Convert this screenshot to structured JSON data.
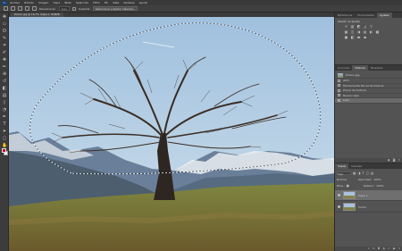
{
  "app": {
    "logo": "Ps"
  },
  "menubar": {
    "items": [
      "Archivo",
      "Edición",
      "Imagen",
      "Capa",
      "Texto",
      "Selección",
      "Filtro",
      "3D",
      "Vista",
      "Ventana",
      "Ayuda"
    ]
  },
  "options": {
    "feather_label": "Desvanecer:",
    "feather_value": "0 px",
    "antialias_label": "Suavizar",
    "refine_button": "Seleccionar y aplicar máscara..."
  },
  "document": {
    "tab_title": "Pinzon.jpg @ 16,7% (Capa 1, RGB/8)"
  },
  "toolbar": {
    "fg_color": "#c8102e",
    "bg_color": "#ffffff",
    "tools": [
      "move-icon",
      "marquee-icon",
      "lasso-icon",
      "quick-select-icon",
      "crop-icon",
      "eyedropper-icon",
      "healing-icon",
      "brush-icon",
      "clone-icon",
      "history-brush-icon",
      "eraser-icon",
      "gradient-icon",
      "blur-icon",
      "dodge-icon",
      "pen-icon",
      "type-icon",
      "path-select-icon",
      "shape-icon",
      "hand-icon",
      "zoom-icon"
    ]
  },
  "adjustments": {
    "tabs": [
      "Bibliotecas",
      "Propiedades",
      "Ajustes"
    ],
    "active_tab": "Ajustes",
    "add_label": "Añadir un ajuste",
    "icons_row1": [
      "☼",
      "▥",
      "◩",
      "◿",
      "▽",
      "",
      "",
      ""
    ],
    "icons_row2": [
      "▦",
      "◫",
      "◑",
      "▤",
      "◐",
      "▩",
      "",
      ""
    ],
    "icons_row3": [
      "▣",
      "◧",
      "▬",
      "▪",
      "",
      "",
      "",
      ""
    ]
  },
  "history": {
    "tabs": [
      "Acciones",
      "Historia",
      "Muestras"
    ],
    "active_tab": "Historia",
    "snapshot": "Pinzon.jpg",
    "steps": [
      "Abrir",
      "Herramienta Pincel de historia",
      "Pincel de historia",
      "Nueva capa",
      "Lazo"
    ],
    "active_index": 4
  },
  "layers": {
    "tabs": [
      "Capas",
      "Canales"
    ],
    "active_tab": "Capas",
    "kind_label": "Tipo",
    "blend_mode": "Normal",
    "opacity_label": "Opacidad:",
    "opacity_value": "100%",
    "lock_label": "Bloq.:",
    "fill_label": "Relleno:",
    "fill_value": "100%",
    "rows": [
      {
        "name": "Capa 1",
        "active": true
      },
      {
        "name": "Fondo",
        "active": false
      }
    ]
  }
}
